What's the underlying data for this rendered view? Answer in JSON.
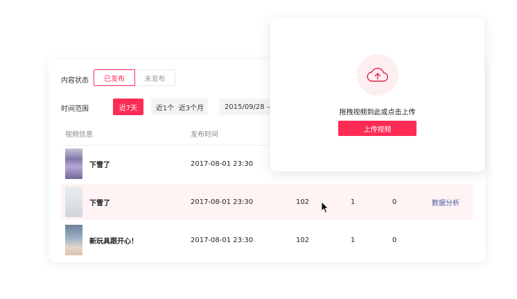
{
  "filters": {
    "status_label": "内容状态",
    "status_options": [
      "已发布",
      "未发布"
    ],
    "time_label": "时间范围",
    "time_options": [
      "近7天",
      "近1个月",
      "近3个月"
    ],
    "date_range": "2015/09/28 –"
  },
  "table": {
    "headers": [
      "视频信息",
      "发布时间"
    ],
    "rows": [
      {
        "title": "下雪了",
        "time": "2017-08-01 23:30",
        "c1": "",
        "c2": "",
        "c3": "",
        "action": ""
      },
      {
        "title": "下雪了",
        "time": "2017-08-01 23:30",
        "c1": "102",
        "c2": "1",
        "c3": "0",
        "action": "数据分析"
      },
      {
        "title": "新玩具跟开心！",
        "time": "2017-08-01 23:30",
        "c1": "102",
        "c2": "1",
        "c3": "0",
        "action": ""
      }
    ]
  },
  "upload": {
    "hint": "拖拽视频到此或点击上传",
    "button": "上传视频"
  },
  "colors": {
    "accent": "#fe2c55",
    "link": "#4a5a9a",
    "highlight_row": "#fff3f4"
  }
}
